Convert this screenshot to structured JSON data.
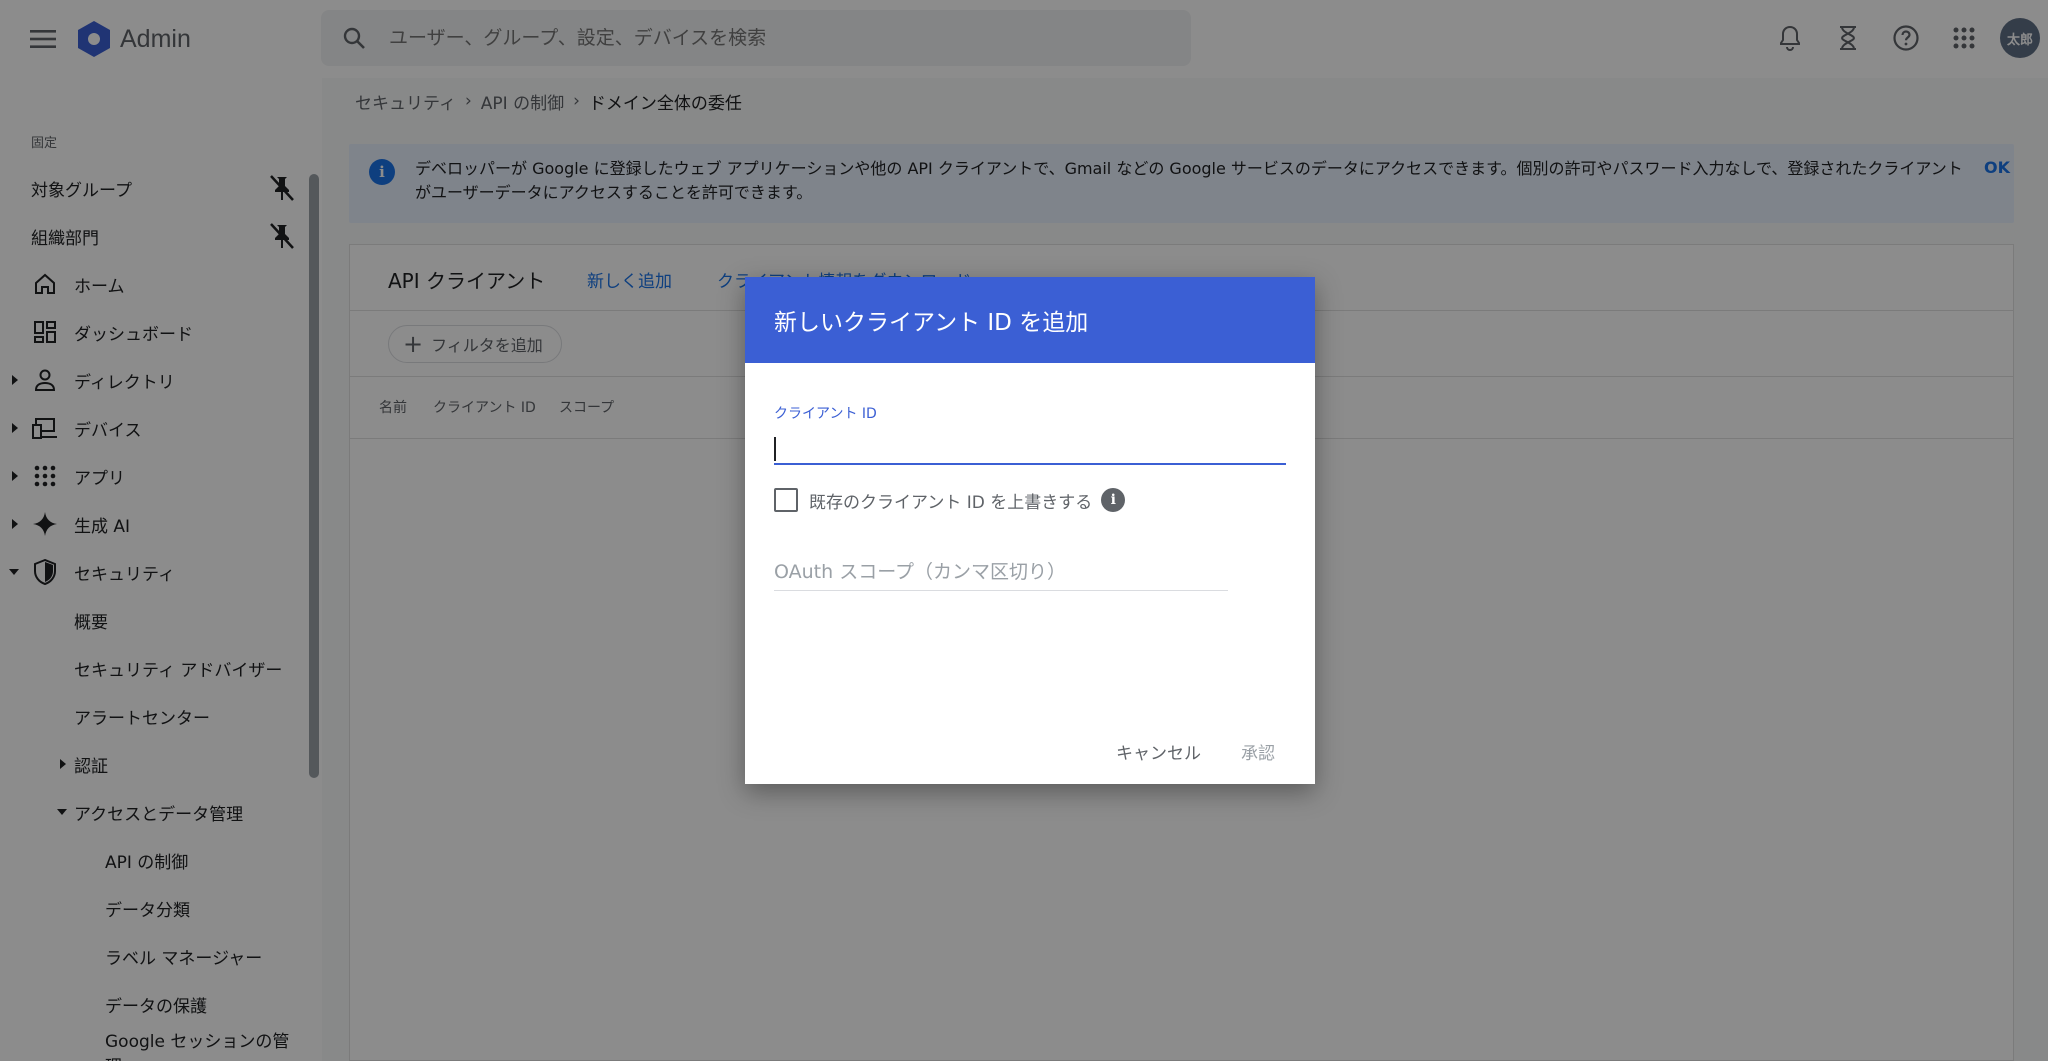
{
  "header": {
    "app_name": "Admin",
    "search_placeholder": "ユーザー、グループ、設定、デバイスを検索",
    "avatar_text": "太郎"
  },
  "sidebar": {
    "section_label": "固定",
    "pinned": [
      {
        "label": "対象グループ"
      },
      {
        "label": "組織部門"
      }
    ],
    "items": [
      {
        "label": "ホーム"
      },
      {
        "label": "ダッシュボード"
      },
      {
        "label": "ディレクトリ"
      },
      {
        "label": "デバイス"
      },
      {
        "label": "アプリ"
      },
      {
        "label": "生成 AI"
      },
      {
        "label": "セキュリティ"
      }
    ],
    "security_children": [
      {
        "label": "概要"
      },
      {
        "label": "セキュリティ アドバイザー"
      },
      {
        "label": "アラートセンター"
      },
      {
        "label": "認証"
      },
      {
        "label": "アクセスとデータ管理"
      }
    ],
    "access_children": [
      {
        "label": "API の制御"
      },
      {
        "label": "データ分類"
      },
      {
        "label": "ラベル マネージャー"
      },
      {
        "label": "データの保護"
      },
      {
        "label": "Google セッションの管理"
      }
    ]
  },
  "breadcrumb": {
    "items": [
      "セキュリティ",
      "API の制御",
      "ドメイン全体の委任"
    ],
    "separator": "›"
  },
  "info_banner": {
    "text": "デベロッパーが Google に登録したウェブ アプリケーションや他の API クライアントで、Gmail などの Google サービスのデータにアクセスできます。個別の許可やパスワード入力なしで、登録されたクライアントがユーザーデータにアクセスすることを許可できます。",
    "ok_label": "OK"
  },
  "card": {
    "title": "API クライアント",
    "add_new_label": "新しく追加",
    "download_label": "クライアント情報をダウンロード",
    "filter_label": "フィルタを追加",
    "columns": [
      "名前",
      "クライアント ID",
      "スコープ"
    ]
  },
  "dialog": {
    "title": "新しいクライアント ID を追加",
    "client_id_label": "クライアント ID",
    "client_id_value": "",
    "overwrite_label": "既存のクライアント ID を上書きする",
    "scope_placeholder": "OAuth スコープ（カンマ区切り）",
    "cancel_label": "キャンセル",
    "approve_label": "承認"
  },
  "colors": {
    "accent": "#3b5fd4",
    "link": "#1a73e8",
    "banner_bg": "#e8f0fe"
  }
}
